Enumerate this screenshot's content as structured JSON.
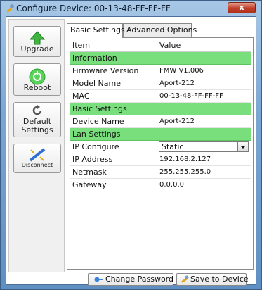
{
  "window": {
    "title": "Configure Device: 00-13-48-FF-FF-FF",
    "close_label": "x"
  },
  "sidebar": {
    "upgrade_label": "Upgrade",
    "reboot_label": "Reboot",
    "default_settings_label_line1": "Default",
    "default_settings_label_line2": "Settings",
    "disconnect_label": "Disconnect"
  },
  "tabs": {
    "basic": "Basic Settings",
    "advanced": "Advanced Options"
  },
  "table": {
    "header": {
      "item": "Item",
      "value": "Value"
    },
    "rows": [
      {
        "item": "Information",
        "value": ""
      },
      {
        "item": "Firmware Version",
        "value": "FMW V1.006"
      },
      {
        "item": "Model Name",
        "value": "Aport-212"
      },
      {
        "item": "MAC",
        "value": "00-13-48-FF-FF-FF"
      },
      {
        "item": "Basic Settings",
        "value": ""
      },
      {
        "item": "Device Name",
        "value": "Aport-212"
      },
      {
        "item": "Lan Settings",
        "value": ""
      },
      {
        "item": "IP Configure",
        "value": "Static"
      },
      {
        "item": "IP Address",
        "value": "192.168.2.127"
      },
      {
        "item": "Netmask",
        "value": "255.255.255.0"
      },
      {
        "item": "Gateway",
        "value": "0.0.0.0"
      }
    ]
  },
  "footer": {
    "change_password_label": "Change Password",
    "save_label": "Save to Device"
  },
  "colors": {
    "section_background": "#79df7c",
    "window_frame": "#7aa6d2"
  }
}
